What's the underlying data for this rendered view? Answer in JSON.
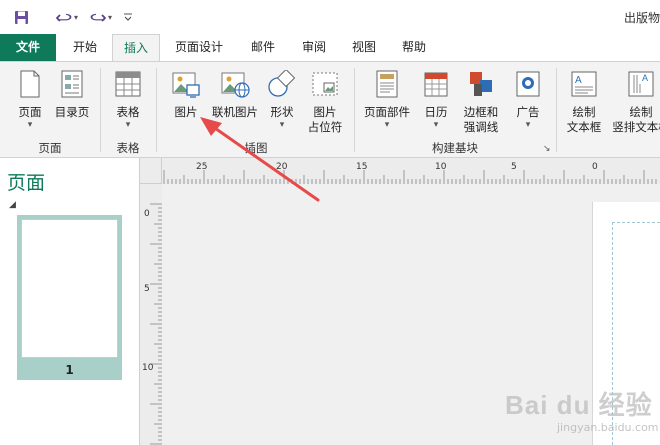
{
  "window": {
    "title": "出版物",
    "qat": {
      "save_icon": "save-icon",
      "undo_icon": "undo-icon",
      "redo_icon": "redo-icon",
      "customize_icon": "customize-qat-icon"
    }
  },
  "tabs": [
    {
      "label": "文件"
    },
    {
      "label": "开始"
    },
    {
      "label": "插入"
    },
    {
      "label": "页面设计"
    },
    {
      "label": "邮件"
    },
    {
      "label": "审阅"
    },
    {
      "label": "视图"
    },
    {
      "label": "帮助"
    }
  ],
  "ribbon": {
    "groups": {
      "pages": "页面",
      "tables": "表格",
      "illustrations": "插图",
      "building_blocks": "构建基块"
    },
    "buttons": {
      "page": "页面",
      "catalog_page": "目录页",
      "table": "表格",
      "picture": "图片",
      "online_picture": "联机图片",
      "shapes": "形状",
      "placeholder_line1": "图片",
      "placeholder_line2": "占位符",
      "page_parts": "页面部件",
      "calendar": "日历",
      "borders_line1": "边框和",
      "borders_line2": "强调线",
      "ads": "广告",
      "draw_textbox_line1": "绘制",
      "draw_textbox_line2": "文本框",
      "draw_vertical_line1": "绘制",
      "draw_vertical_line2": "竖排文本框"
    },
    "caret": "▾",
    "launcher": "↘"
  },
  "pages_pane": {
    "title": "页面",
    "collapse": "◢",
    "thumbnails": [
      {
        "number": "1"
      }
    ]
  },
  "ruler": {
    "h_labels": [
      "25",
      "20",
      "15",
      "10",
      "5",
      "0"
    ],
    "v_labels": [
      "0",
      "5",
      "10"
    ]
  },
  "colors": {
    "accent": "#0e7a5a",
    "arrow": "#e64a4a"
  },
  "watermark": {
    "text": "Bai du 经验",
    "sub": "jingyan.baidu.com"
  }
}
